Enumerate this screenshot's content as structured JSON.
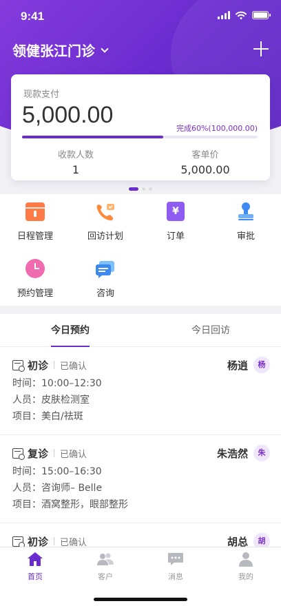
{
  "status_bar": {
    "time": "9:41"
  },
  "header": {
    "clinic_name": "领健张江门诊"
  },
  "summary": {
    "label": "现款支付",
    "amount": "5,000.00",
    "progress_text": "完成60%(100,000.00)",
    "progress_fraction": 0.6,
    "stats": [
      {
        "label": "收款人数",
        "value": "1"
      },
      {
        "label": "客单价",
        "value": "5,000.00"
      }
    ]
  },
  "pager": {
    "count": 3,
    "active": 0
  },
  "menu": {
    "items": [
      {
        "label": "日程管理",
        "icon": "calendar-icon"
      },
      {
        "label": "回访计划",
        "icon": "phone-callback-icon"
      },
      {
        "label": "订单",
        "icon": "order-icon"
      },
      {
        "label": "审批",
        "icon": "stamp-icon"
      },
      {
        "label": "预约管理",
        "icon": "clock-icon"
      },
      {
        "label": "咨询",
        "icon": "chat-icon"
      }
    ],
    "order_symbol": "¥"
  },
  "tabs": [
    {
      "label": "今日预约",
      "active": true
    },
    {
      "label": "今日回访",
      "active": false
    }
  ],
  "appointments": [
    {
      "type": "初诊",
      "status": "已确认",
      "name": "杨逍",
      "avatar": "杨",
      "time_label": "时间：",
      "time": "10:00–12:30",
      "staff_label": "人员：",
      "staff": "皮肤检测室",
      "item_label": "项目：",
      "item": "美白/祛斑"
    },
    {
      "type": "复诊",
      "status": "已确认",
      "name": "朱浩然",
      "avatar": "朱",
      "time_label": "时间：",
      "time": "15:00–16:30",
      "staff_label": "人员：",
      "staff": "咨询师– Belle",
      "item_label": "项目：",
      "item": "酒窝整形，眼部整形"
    },
    {
      "type": "初诊",
      "status": "已确认",
      "name": "胡总",
      "avatar": "胡",
      "time_label": "",
      "time": "",
      "staff_label": "",
      "staff": "",
      "item_label": "",
      "item": ""
    }
  ],
  "tabbar": {
    "items": [
      {
        "label": "首页",
        "icon": "home-icon",
        "active": true
      },
      {
        "label": "客户",
        "icon": "customers-icon",
        "active": false
      },
      {
        "label": "消息",
        "icon": "message-icon",
        "active": false
      },
      {
        "label": "我的",
        "icon": "profile-icon",
        "active": false
      }
    ]
  },
  "colors": {
    "primary": "#6a2ccf",
    "accent_text": "#7a2fc7",
    "orange": "#ff7a45",
    "purple_icon": "#8e5cf0",
    "pink": "#f06bb0",
    "blue": "#3d8bf0"
  }
}
